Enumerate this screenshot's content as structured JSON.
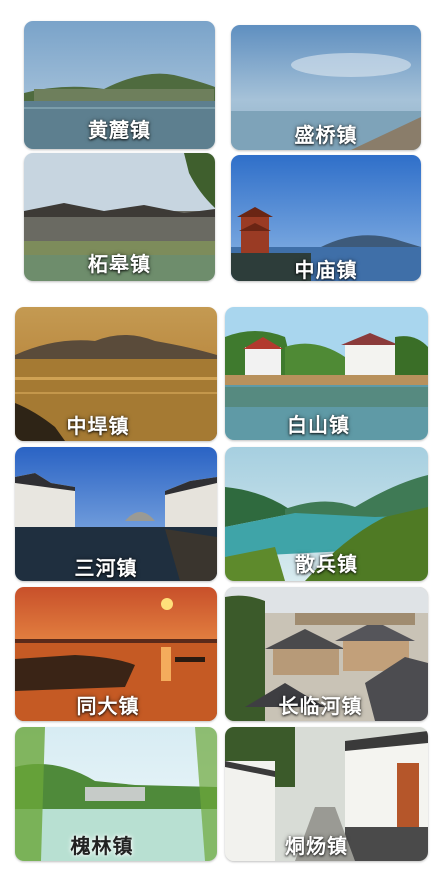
{
  "towns": [
    {
      "name": "黄麓镇"
    },
    {
      "name": "盛桥镇"
    },
    {
      "name": "柘皋镇"
    },
    {
      "name": "中庙镇"
    },
    {
      "name": "中垾镇"
    },
    {
      "name": "白山镇"
    },
    {
      "name": "三河镇"
    },
    {
      "name": "散兵镇"
    },
    {
      "name": "同大镇"
    },
    {
      "name": "长临河镇"
    },
    {
      "name": "槐林镇"
    },
    {
      "name": "烔炀镇"
    }
  ]
}
